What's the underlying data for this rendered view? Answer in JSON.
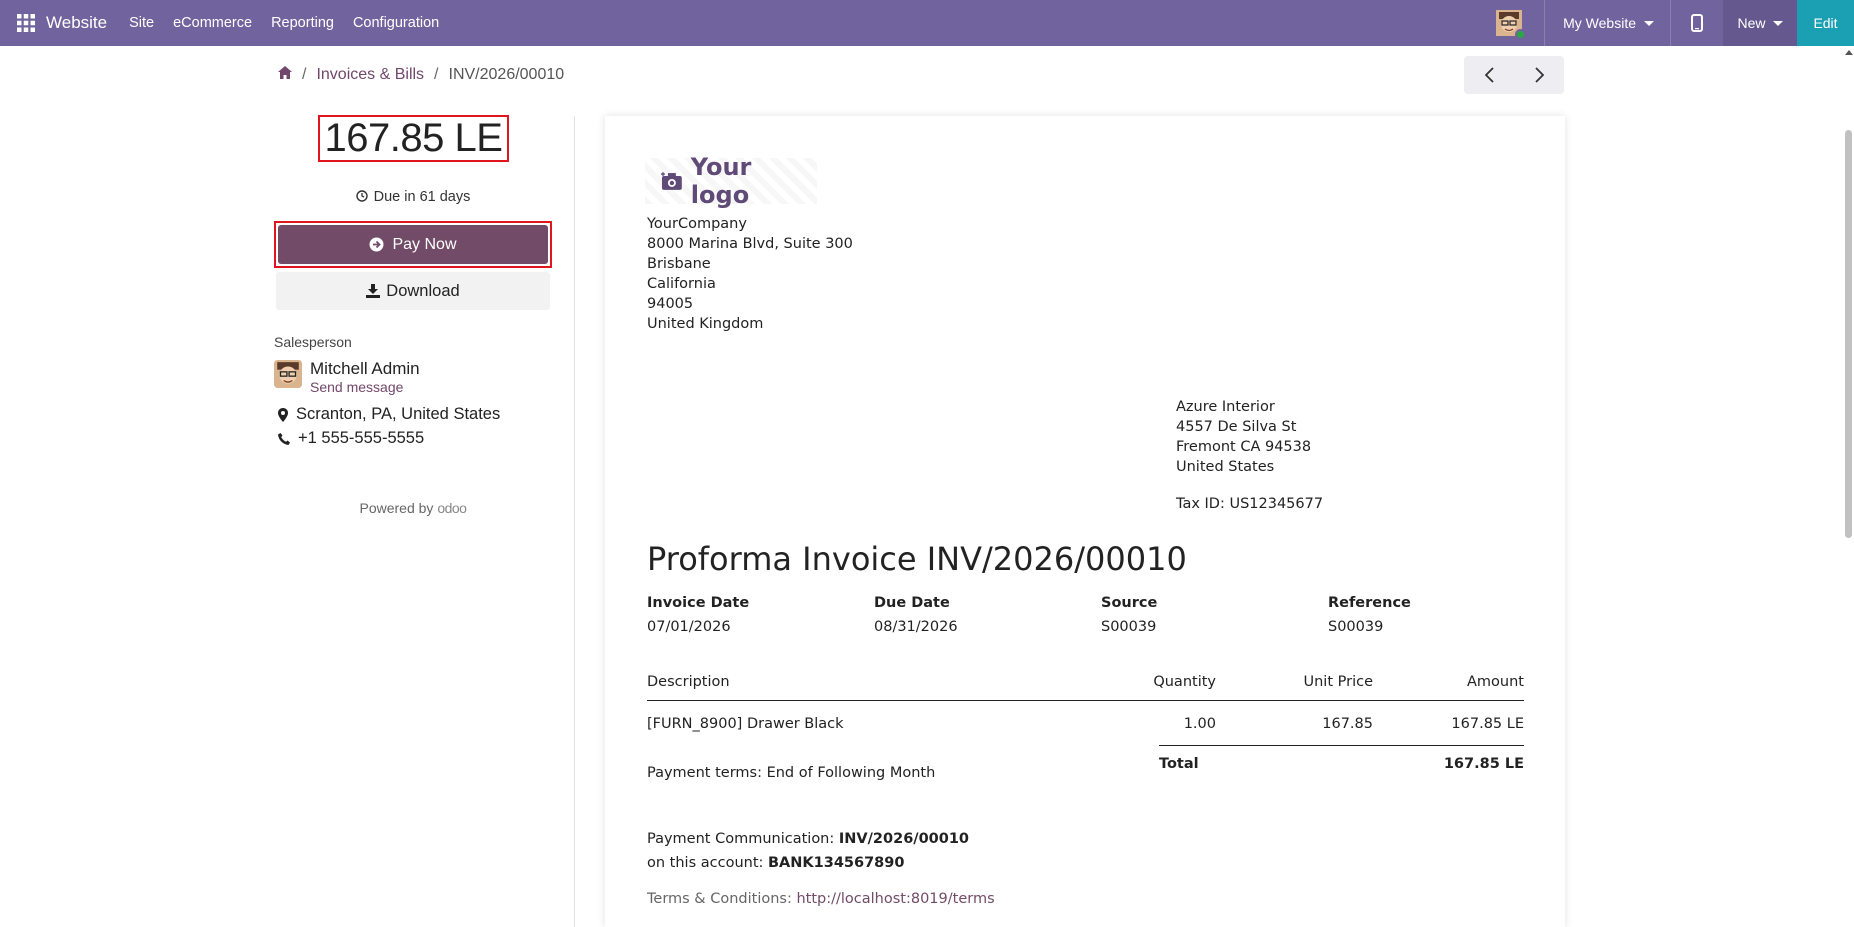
{
  "topbar": {
    "brand": "Website",
    "menu": [
      "Site",
      "eCommerce",
      "Reporting",
      "Configuration"
    ],
    "my_website": "My Website",
    "new_label": "New",
    "edit_label": "Edit",
    "bg_color": "#71639e"
  },
  "breadcrumb": {
    "section": "Invoices & Bills",
    "current": "INV/2026/00010"
  },
  "sidebar": {
    "amount": "167.85 LE",
    "due": "Due in 61 days",
    "pay_now": "Pay Now",
    "download": "Download",
    "salesperson_label": "Salesperson",
    "salesperson_name": "Mitchell Admin",
    "send_message": "Send message",
    "location": "Scranton, PA, United States",
    "phone": "+1 555-555-5555",
    "powered_by": "Powered by",
    "odoo": "odoo"
  },
  "invoice": {
    "logo_text": "Your logo",
    "company": {
      "name": "YourCompany",
      "street": "8000 Marina Blvd, Suite 300",
      "city": "Brisbane",
      "state": "California",
      "zip": "94005",
      "country": "United Kingdom"
    },
    "customer": {
      "name": "Azure Interior",
      "street": "4557 De Silva St",
      "city_line": "Fremont CA 94538",
      "country": "United States",
      "tax_id": "Tax ID: US12345677"
    },
    "title": "Proforma Invoice INV/2026/00010",
    "meta": [
      {
        "label": "Invoice Date",
        "value": "07/01/2026"
      },
      {
        "label": "Due Date",
        "value": "08/31/2026"
      },
      {
        "label": "Source",
        "value": "S00039"
      },
      {
        "label": "Reference",
        "value": "S00039"
      }
    ],
    "columns": {
      "description": "Description",
      "quantity": "Quantity",
      "unit_price": "Unit Price",
      "amount": "Amount"
    },
    "lines": [
      {
        "description": "[FURN_8900] Drawer Black",
        "quantity": "1.00",
        "unit_price": "167.85",
        "amount": "167.85 LE"
      }
    ],
    "total_label": "Total",
    "total_value": "167.85 LE",
    "payment_terms": "Payment terms: End of Following Month",
    "payment_comm_label": "Payment Communication:",
    "payment_comm_value": "INV/2026/00010",
    "account_label": "on this account:",
    "account_value": "BANK134567890",
    "terms_label": "Terms & Conditions:",
    "terms_link": "http://localhost:8019/terms"
  }
}
